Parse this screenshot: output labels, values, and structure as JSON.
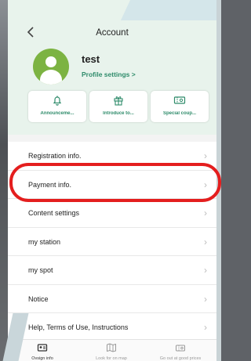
{
  "header": {
    "back_icon": "chevron-left-icon",
    "title": "Account"
  },
  "profile": {
    "username": "test",
    "settings_link": "Profile settings >"
  },
  "cards": [
    {
      "icon": "bell-icon",
      "label": "Announceme..."
    },
    {
      "icon": "gift-icon",
      "label": "Introduce to..."
    },
    {
      "icon": "coupon-icon",
      "label": "Special coup..."
    }
  ],
  "menu": [
    {
      "label": "Registration info."
    },
    {
      "label": "Payment info."
    },
    {
      "label": "Content settings"
    },
    {
      "label": "my station"
    },
    {
      "label": "my spot"
    },
    {
      "label": "Notice"
    },
    {
      "label": "Help, Terms of Use, Instructions"
    }
  ],
  "tabs": [
    {
      "icon": "user-card-icon",
      "label": "Ovsign info",
      "active": true
    },
    {
      "icon": "map-icon",
      "label": "Look for on map",
      "active": false
    },
    {
      "icon": "ticket-icon",
      "label": "Go out at good prices",
      "active": false
    }
  ],
  "colors": {
    "accent": "#2e8b6a",
    "highlight": "#e41e1e",
    "header_bg": "#e8f3ec",
    "avatar": "#7cb342"
  }
}
